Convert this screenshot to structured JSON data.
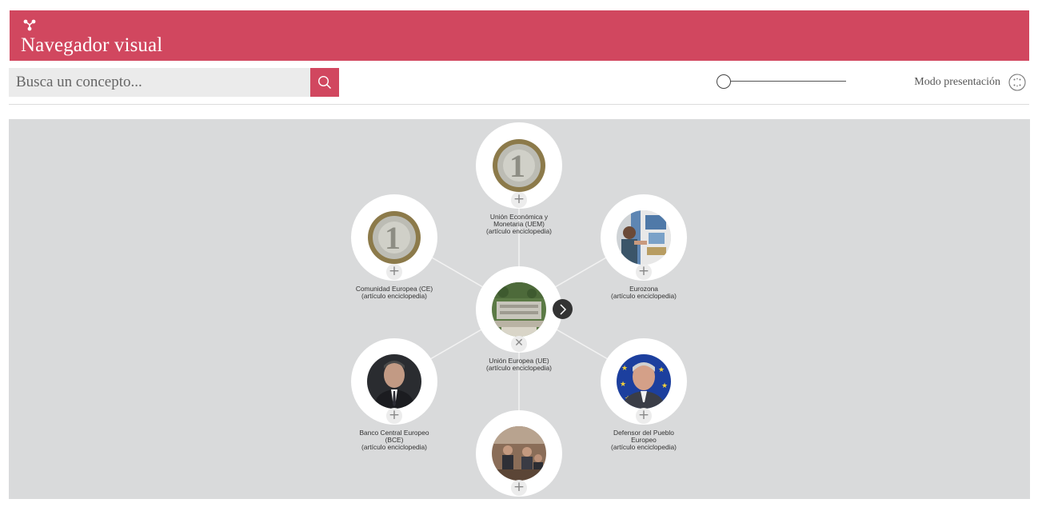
{
  "header": {
    "logo_icon": "network-nodes-icon",
    "title": "Navegador visual"
  },
  "search": {
    "placeholder": "Busca un concepto...",
    "value": "",
    "button_icon": "search-icon"
  },
  "zoom_slider": {
    "value": 0
  },
  "presentation_mode": {
    "label": "Modo presentación",
    "icon": "fullscreen-dots-icon"
  },
  "colors": {
    "accent": "#d1475f",
    "graph_background": "#d9dadb",
    "edge": "#f2f2f2",
    "node_disc": "#ffffff"
  },
  "graph": {
    "center": {
      "id": "ue",
      "lines": [
        "Unión Europea (UE)",
        "(artículo enciclopedia)"
      ],
      "image": "aerial-photo-buildings",
      "action": "close"
    },
    "next_icon": "chevron-right-icon",
    "nodes": [
      {
        "id": "uem",
        "lines": [
          "Unión Económica y",
          "Monetaria (UEM)",
          "(artículo enciclopedia)"
        ],
        "image": "euro-coin",
        "action": "add"
      },
      {
        "id": "ce",
        "lines": [
          "Comunidad Europea (CE)",
          "(artículo enciclopedia)"
        ],
        "image": "euro-coin",
        "action": "add"
      },
      {
        "id": "eurozona",
        "lines": [
          "Eurozona",
          "(artículo enciclopedia)"
        ],
        "image": "atm-machine-photo",
        "action": "add"
      },
      {
        "id": "bce",
        "lines": [
          "Banco Central Europeo",
          "(BCE)",
          "(artículo enciclopedia)"
        ],
        "image": "man-in-suit-portrait",
        "action": "add"
      },
      {
        "id": "defensor",
        "lines": [
          "Defensor del Pueblo",
          "Europeo",
          "(artículo enciclopedia)"
        ],
        "image": "man-eu-flag-portrait",
        "action": "add"
      },
      {
        "id": "bottom",
        "lines": [],
        "image": "meeting-room-photo",
        "action": "add"
      }
    ]
  }
}
